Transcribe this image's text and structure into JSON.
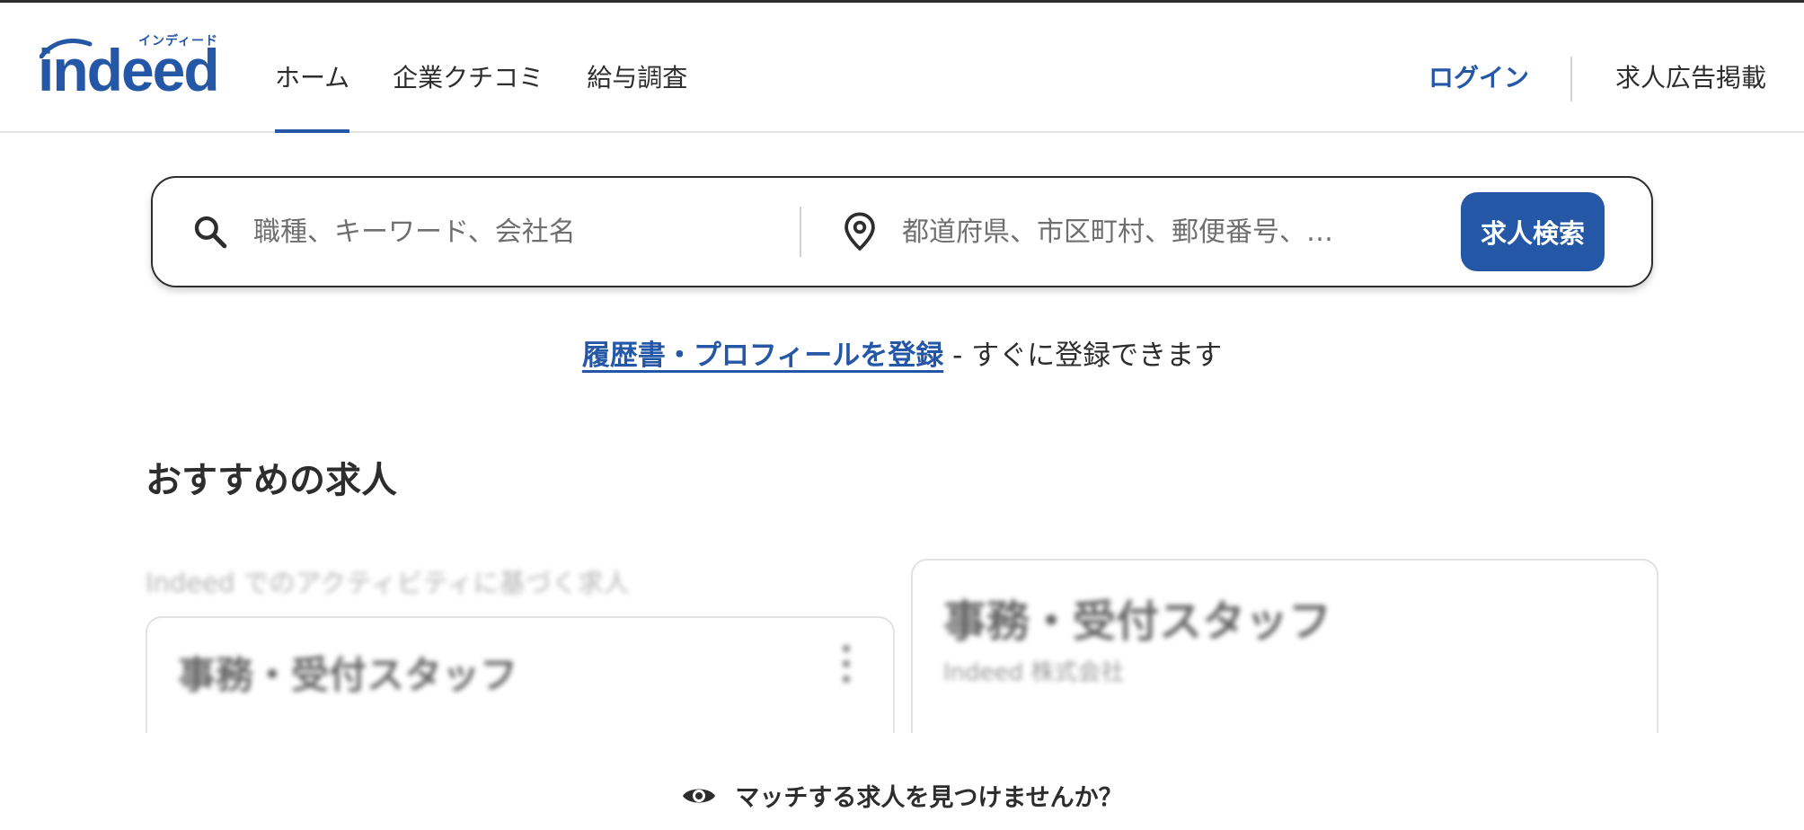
{
  "header": {
    "logo_text": "indeed",
    "logo_kana": "インディード",
    "nav": [
      {
        "label": "ホーム",
        "active": true
      },
      {
        "label": "企業クチコミ",
        "active": false
      },
      {
        "label": "給与調査",
        "active": false
      }
    ],
    "login_label": "ログイン",
    "employers_label": "求人広告掲載"
  },
  "search": {
    "what_placeholder": "職種、キーワード、会社名",
    "what_value": "",
    "where_placeholder": "都道府県、市区町村、郵便番号、…",
    "where_value": "",
    "button_label": "求人検索",
    "icons": {
      "what": "search-icon",
      "where": "location-pin-icon"
    }
  },
  "resume": {
    "link_text": "履歴書・プロフィールを登録",
    "rest_text": " - すぐに登録できます"
  },
  "recommended": {
    "title": "おすすめの求人",
    "activity_label": "Indeed でのアクティビティに基づく求人",
    "jobs": [
      {
        "title": "事務・受付スタッフ",
        "company": ""
      },
      {
        "title": "事務・受付スタッフ",
        "company": "Indeed 株式会社"
      }
    ]
  },
  "match_prompt": {
    "icon": "eye-icon",
    "text": "マッチする求人を見つけませんか？"
  },
  "colors": {
    "brand": "#2557a7",
    "text": "#2d2d2d",
    "border": "#e4e2e0"
  }
}
